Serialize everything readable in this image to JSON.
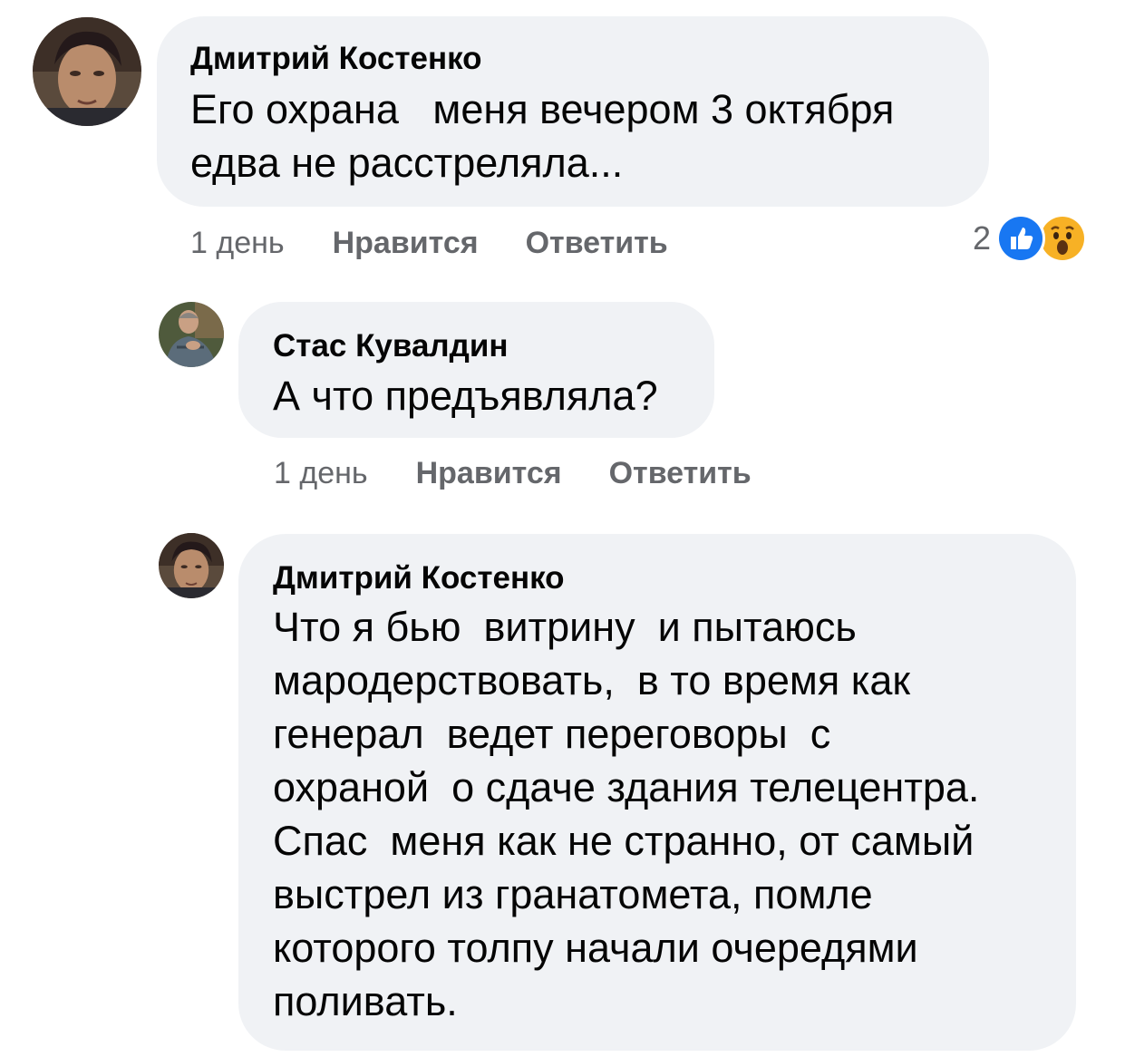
{
  "comments": [
    {
      "author": "Дмитрий Костенко",
      "text": "Его охрана   меня вечером 3 октября\nедва не расстреляла...",
      "time": "1 день",
      "like_label": "Нравится",
      "reply_label": "Ответить",
      "reaction_count": "2",
      "reactions": [
        "like-icon",
        "wow-icon"
      ]
    },
    {
      "author": "Стас Кувалдин",
      "text": "А что предъявляла?",
      "time": "1 день",
      "like_label": "Нравится",
      "reply_label": "Ответить"
    },
    {
      "author": "Дмитрий Костенко",
      "text": "Что я бью  витрину  и пытаюсь\nмародерствовать,  в то время как\nгенерал  ведет переговоры  с\nохраной  о сдаче здания телецентра.\nСпас  меня как не странно, от самый\nвыстрел из гранатомета, помле\nкоторого толпу начали очередями\nполивать."
    }
  ],
  "colors": {
    "bubble": "#f0f2f5",
    "secondary_text": "#65676b",
    "like_blue": "#1877f2",
    "wow_yellow": "#f7b125"
  }
}
